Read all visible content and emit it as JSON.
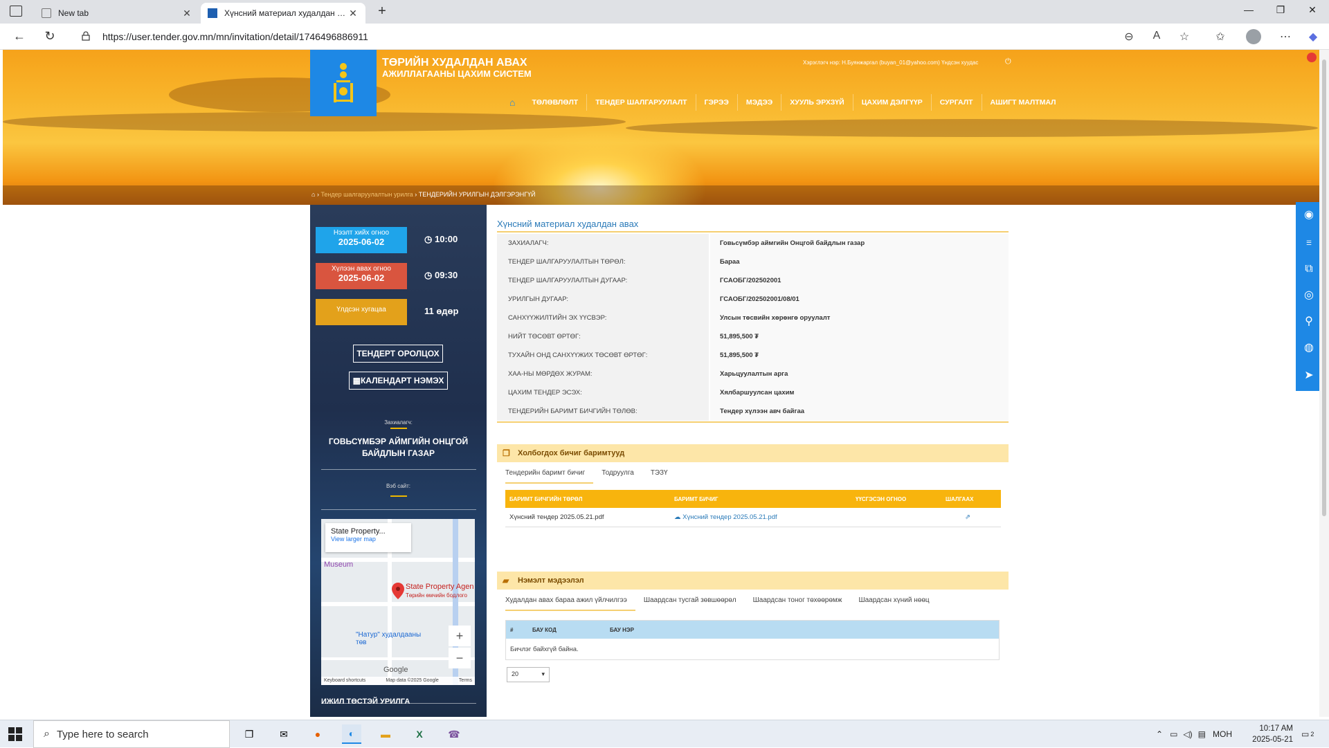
{
  "browser": {
    "tabs": [
      {
        "title": "New tab"
      },
      {
        "title": "Хүнсний материал худалдан авах"
      }
    ],
    "url": "https://user.tender.gov.mn/mn/invitation/detail/1746496886911"
  },
  "header": {
    "title": "ТӨРИЙН ХУДАЛДАН АВАХ",
    "subtitle": "АЖИЛЛАГААНЫ ЦАХИМ СИСТЕМ",
    "user_line": "Хэрэглэгч нэр: Н.Буянжаргал (buyan_01@yahoo.com)   Үндсэн хуудас",
    "nav": [
      "ТӨЛӨВЛӨЛТ",
      "ТЕНДЕР ШАЛГАРУУЛАЛТ",
      "ГЭРЭЭ",
      "МЭДЭЭ",
      "ХУУЛЬ ЭРХЗҮЙ",
      "ЦАХИМ ДЭЛГҮҮР",
      "СУРГАЛТ",
      "АШИГТ МАЛТМАЛ"
    ],
    "breadcrumb_link": "Тендер шалгаруулалтын урилга",
    "breadcrumb_current": "ТЕНДЕРИЙН УРИЛГЫН ДЭЛГЭРЭНГҮЙ"
  },
  "left": {
    "open_label": "Нээлт хийх огноо",
    "open_date": "2025-06-02",
    "open_time": "10:00",
    "receive_label": "Хүлээн авах огноо",
    "receive_date": "2025-06-02",
    "receive_time": "09:30",
    "remaining_label": "Үлдсэн хугацаа",
    "remaining_value": "11 өдөр",
    "participate_btn": "ТЕНДЕРТ ОРОЛЦОХ",
    "calendar_btn": "КАЛЕНДАРТ НЭМЭХ",
    "client_label": "Захиалагч:",
    "client_name": "ГОВЬСҮМБЭР АЙМГИЙН ОНЦГОЙ БАЙДЛЫН ГАЗАР",
    "website_label": "Вэб сайт:",
    "map": {
      "popup_title": "State Property...",
      "popup_link": "View larger map",
      "pin_label": "State Property Agen",
      "pin_sub": "Төрийн өмчийн бодлого",
      "museum": "Museum",
      "natur": "\"Натур\" худалдааны төв",
      "footer_left": "Keyboard shortcuts",
      "footer_mid": "Map data ©2025 Google",
      "footer_right": "Terms",
      "google": "Google"
    },
    "work_days": "ИЖИЛ ТӨСТЭЙ УРИЛГА"
  },
  "main": {
    "title": "Хүнсний материал худалдан авах",
    "info": [
      {
        "label": "ЗАХИАЛАГЧ:",
        "value": "Говьсүмбэр аймгийн Онцгой байдлын газар"
      },
      {
        "label": "ТЕНДЕР ШАЛГАРУУЛАЛТЫН ТӨРӨЛ:",
        "value": "Бараа"
      },
      {
        "label": "ТЕНДЕР ШАЛГАРУУЛАЛТЫН ДУГААР:",
        "value": "ГСАОБГ/202502001"
      },
      {
        "label": "УРИЛГЫН ДУГААР:",
        "value": "ГСАОБГ/202502001/08/01"
      },
      {
        "label": "САНХҮҮЖИЛТИЙН ЭХ ҮҮСВЭР:",
        "value": "Улсын төсвийн хөрөнгө оруулалт"
      },
      {
        "label": "НИЙТ ТӨСӨВТ ӨРТӨГ:",
        "value": "51,895,500 ₮"
      },
      {
        "label": "ТУХАЙН ОНД САНХҮҮЖИХ ТӨСӨВТ ӨРТӨГ:",
        "value": "51,895,500 ₮"
      },
      {
        "label": "ХАА-НЫ МӨРДӨХ ЖУРАМ:",
        "value": "Харьцуулалтын арга"
      },
      {
        "label": "ЦАХИМ ТЕНДЕР ЭСЭХ:",
        "value": "Хялбаршуулсан цахим"
      },
      {
        "label": "ТЕНДЕРИЙН БАРИМТ БИЧГИЙН ТӨЛӨВ:",
        "value": "Тендер хүлээн авч байгаа"
      }
    ],
    "docs_section": "Холбогдох бичиг баримтууд",
    "docs_tabs": [
      "Тендерийн баримт бичиг",
      "Тодруулга",
      "ТЭЗҮ"
    ],
    "docs_headers": [
      "БАРИМТ БИЧГИЙН ТӨРӨЛ",
      "БАРИМТ БИЧИГ",
      "ҮҮСГЭСЭН ОГНОО",
      "ШАЛГААХ"
    ],
    "docs_rows": [
      {
        "type": "Хүнсний тендер 2025.05.21.pdf",
        "file": "Хүнсний тендер 2025.05.21.pdf",
        "date": ""
      }
    ],
    "extra_section": "Нэмэлт мэдээлэл",
    "extra_tabs": [
      "Худалдан авах бараа ажил үйлчилгээ",
      "Шаардсан тусгай зөвшөөрөл",
      "Шаардсан тоног төхөөрөмж",
      "Шаардсан хүний нөөц"
    ],
    "bau_headers": [
      "#",
      "БАУ КОД",
      "БАУ НЭР"
    ],
    "bau_empty": "Бичлэг байхгүй байна.",
    "page_size": "20"
  },
  "taskbar": {
    "search_placeholder": "Type here to search",
    "lang": "МОН",
    "time": "10:17 AM",
    "date": "2025-05-21",
    "notif_count": "2"
  },
  "colors": {
    "accent_blue": "#1e88e5",
    "gold": "#f8b40d",
    "section_bg": "#fde6a8",
    "badge_open": "#1fa4ea",
    "badge_receive": "#d9553f",
    "badge_remaining": "#e3a11b"
  }
}
